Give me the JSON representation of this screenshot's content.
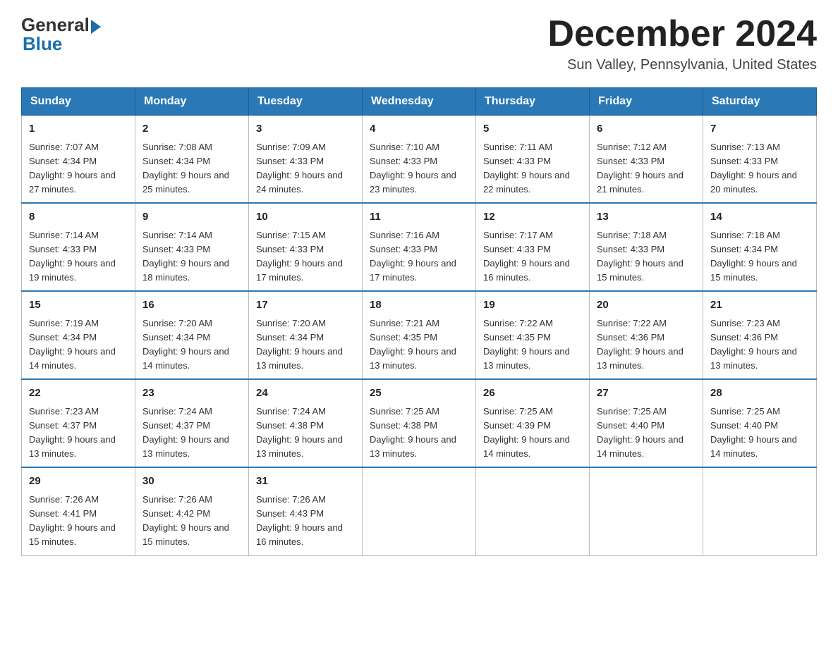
{
  "header": {
    "logo": {
      "general": "General",
      "blue": "Blue"
    },
    "title": "December 2024",
    "location": "Sun Valley, Pennsylvania, United States"
  },
  "days_of_week": [
    "Sunday",
    "Monday",
    "Tuesday",
    "Wednesday",
    "Thursday",
    "Friday",
    "Saturday"
  ],
  "weeks": [
    [
      {
        "day": "1",
        "sunrise": "7:07 AM",
        "sunset": "4:34 PM",
        "daylight": "9 hours and 27 minutes."
      },
      {
        "day": "2",
        "sunrise": "7:08 AM",
        "sunset": "4:34 PM",
        "daylight": "9 hours and 25 minutes."
      },
      {
        "day": "3",
        "sunrise": "7:09 AM",
        "sunset": "4:33 PM",
        "daylight": "9 hours and 24 minutes."
      },
      {
        "day": "4",
        "sunrise": "7:10 AM",
        "sunset": "4:33 PM",
        "daylight": "9 hours and 23 minutes."
      },
      {
        "day": "5",
        "sunrise": "7:11 AM",
        "sunset": "4:33 PM",
        "daylight": "9 hours and 22 minutes."
      },
      {
        "day": "6",
        "sunrise": "7:12 AM",
        "sunset": "4:33 PM",
        "daylight": "9 hours and 21 minutes."
      },
      {
        "day": "7",
        "sunrise": "7:13 AM",
        "sunset": "4:33 PM",
        "daylight": "9 hours and 20 minutes."
      }
    ],
    [
      {
        "day": "8",
        "sunrise": "7:14 AM",
        "sunset": "4:33 PM",
        "daylight": "9 hours and 19 minutes."
      },
      {
        "day": "9",
        "sunrise": "7:14 AM",
        "sunset": "4:33 PM",
        "daylight": "9 hours and 18 minutes."
      },
      {
        "day": "10",
        "sunrise": "7:15 AM",
        "sunset": "4:33 PM",
        "daylight": "9 hours and 17 minutes."
      },
      {
        "day": "11",
        "sunrise": "7:16 AM",
        "sunset": "4:33 PM",
        "daylight": "9 hours and 17 minutes."
      },
      {
        "day": "12",
        "sunrise": "7:17 AM",
        "sunset": "4:33 PM",
        "daylight": "9 hours and 16 minutes."
      },
      {
        "day": "13",
        "sunrise": "7:18 AM",
        "sunset": "4:33 PM",
        "daylight": "9 hours and 15 minutes."
      },
      {
        "day": "14",
        "sunrise": "7:18 AM",
        "sunset": "4:34 PM",
        "daylight": "9 hours and 15 minutes."
      }
    ],
    [
      {
        "day": "15",
        "sunrise": "7:19 AM",
        "sunset": "4:34 PM",
        "daylight": "9 hours and 14 minutes."
      },
      {
        "day": "16",
        "sunrise": "7:20 AM",
        "sunset": "4:34 PM",
        "daylight": "9 hours and 14 minutes."
      },
      {
        "day": "17",
        "sunrise": "7:20 AM",
        "sunset": "4:34 PM",
        "daylight": "9 hours and 13 minutes."
      },
      {
        "day": "18",
        "sunrise": "7:21 AM",
        "sunset": "4:35 PM",
        "daylight": "9 hours and 13 minutes."
      },
      {
        "day": "19",
        "sunrise": "7:22 AM",
        "sunset": "4:35 PM",
        "daylight": "9 hours and 13 minutes."
      },
      {
        "day": "20",
        "sunrise": "7:22 AM",
        "sunset": "4:36 PM",
        "daylight": "9 hours and 13 minutes."
      },
      {
        "day": "21",
        "sunrise": "7:23 AM",
        "sunset": "4:36 PM",
        "daylight": "9 hours and 13 minutes."
      }
    ],
    [
      {
        "day": "22",
        "sunrise": "7:23 AM",
        "sunset": "4:37 PM",
        "daylight": "9 hours and 13 minutes."
      },
      {
        "day": "23",
        "sunrise": "7:24 AM",
        "sunset": "4:37 PM",
        "daylight": "9 hours and 13 minutes."
      },
      {
        "day": "24",
        "sunrise": "7:24 AM",
        "sunset": "4:38 PM",
        "daylight": "9 hours and 13 minutes."
      },
      {
        "day": "25",
        "sunrise": "7:25 AM",
        "sunset": "4:38 PM",
        "daylight": "9 hours and 13 minutes."
      },
      {
        "day": "26",
        "sunrise": "7:25 AM",
        "sunset": "4:39 PM",
        "daylight": "9 hours and 14 minutes."
      },
      {
        "day": "27",
        "sunrise": "7:25 AM",
        "sunset": "4:40 PM",
        "daylight": "9 hours and 14 minutes."
      },
      {
        "day": "28",
        "sunrise": "7:25 AM",
        "sunset": "4:40 PM",
        "daylight": "9 hours and 14 minutes."
      }
    ],
    [
      {
        "day": "29",
        "sunrise": "7:26 AM",
        "sunset": "4:41 PM",
        "daylight": "9 hours and 15 minutes."
      },
      {
        "day": "30",
        "sunrise": "7:26 AM",
        "sunset": "4:42 PM",
        "daylight": "9 hours and 15 minutes."
      },
      {
        "day": "31",
        "sunrise": "7:26 AM",
        "sunset": "4:43 PM",
        "daylight": "9 hours and 16 minutes."
      },
      null,
      null,
      null,
      null
    ]
  ]
}
